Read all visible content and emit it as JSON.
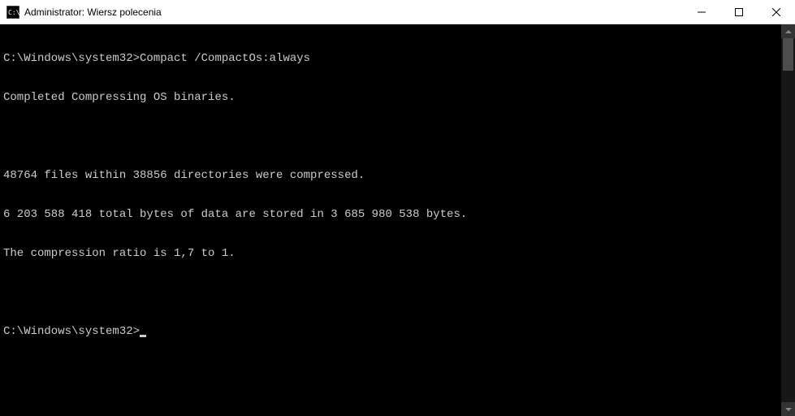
{
  "window": {
    "title": "Administrator: Wiersz polecenia"
  },
  "terminal": {
    "lines": [
      {
        "prompt": "C:\\Windows\\system32>",
        "command": "Compact /CompactOs:always"
      },
      {
        "text": "Completed Compressing OS binaries."
      },
      {
        "text": ""
      },
      {
        "text": "48764 files within 38856 directories were compressed."
      },
      {
        "text": "6 203 588 418 total bytes of data are stored in 3 685 980 538 bytes."
      },
      {
        "text": "The compression ratio is 1,7 to 1."
      },
      {
        "text": ""
      }
    ],
    "current_prompt": "C:\\Windows\\system32>"
  }
}
